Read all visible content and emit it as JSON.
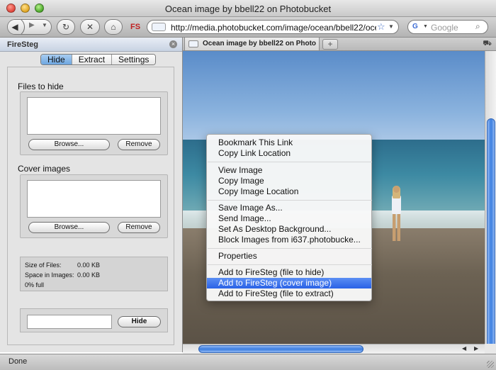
{
  "window": {
    "title": "Ocean image by bbell22 on Photobucket"
  },
  "toolbar": {
    "back_icon": "◀",
    "forward_icon": "▶",
    "history_icon": "▼",
    "reload_icon": "↻",
    "stop_icon": "✕",
    "home_icon": "⌂",
    "fs_label": "FS",
    "url": "http://media.photobucket.com/image/ocean/bbell22/ocean.jp",
    "bookmark_icon": "☆",
    "url_drop_icon": "▼",
    "search_placeholder": "Google",
    "search_drop_icon": "▼",
    "search_icon_glyph": "⌕",
    "google_glyph": "G"
  },
  "sidebar": {
    "title": "FireSteg",
    "close_glyph": "×",
    "tabs": [
      {
        "label": "Hide",
        "active": true
      },
      {
        "label": "Extract",
        "active": false
      },
      {
        "label": "Settings",
        "active": false
      }
    ],
    "files_to_hide": {
      "label": "Files to hide",
      "browse_label": "Browse...",
      "remove_label": "Remove"
    },
    "cover_images": {
      "label": "Cover images",
      "browse_label": "Browse...",
      "remove_label": "Remove"
    },
    "stats": {
      "size_of_files_label": "Size of Files:",
      "size_of_files_value": "0.00 KB",
      "space_in_images_label": "Space in Images:",
      "space_in_images_value": "0.00 KB",
      "full_label": "0% full"
    },
    "hide_button_label": "Hide",
    "password_value": ""
  },
  "tabs": {
    "page_tab_title": "Ocean image by bbell22 on Photo...",
    "new_tab_glyph": "+",
    "tabs_menu_glyph": "⛟"
  },
  "context_menu": {
    "groups": [
      [
        "Bookmark This Link",
        "Copy Link Location"
      ],
      [
        "View Image",
        "Copy Image",
        "Copy Image Location"
      ],
      [
        "Save Image As...",
        "Send Image...",
        "Set As Desktop Background...",
        "Block Images from i637.photobucke..."
      ],
      [
        "Properties"
      ],
      [
        "Add to FireSteg (file to hide)",
        "Add to FireSteg (cover image)",
        "Add to FireSteg (file to extract)"
      ]
    ],
    "highlighted": "Add to FireSteg (cover image)"
  },
  "scroll": {
    "up_glyph": "▲",
    "down_glyph": "▼",
    "left_glyph": "◀",
    "right_glyph": "▶"
  },
  "status": {
    "text": "Done"
  },
  "colors": {
    "highlight": "#2a62e6",
    "fs_red": "#c02020",
    "active_tab": "#6ea6e0"
  }
}
